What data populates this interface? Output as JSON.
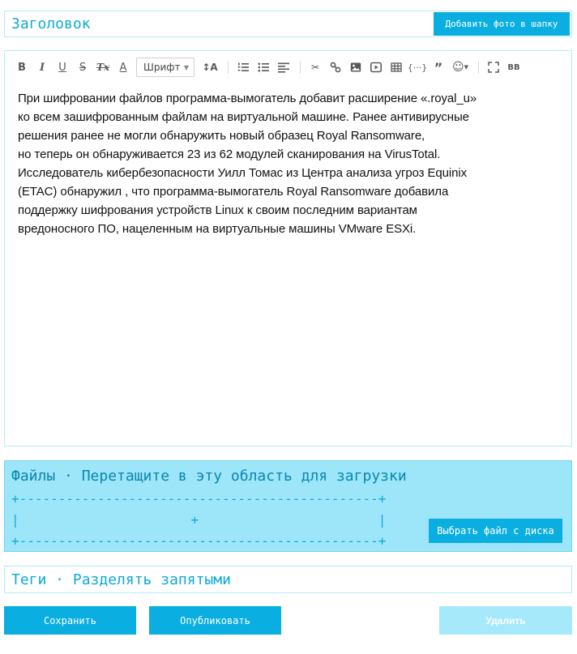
{
  "title_field": {
    "placeholder": "Заголовок",
    "value": ""
  },
  "header_photo_button": {
    "label": "Добавить фото в шапку"
  },
  "toolbar": {
    "bold_label": "B",
    "italic_label": "I",
    "underline_label": "U",
    "strike_label": "S",
    "clear_format_label": "Tx",
    "font_color_label": "A",
    "font_select_value": "Шрифт",
    "font_size_label": "↕A",
    "quote_label": "”",
    "bbcode_label": "BB"
  },
  "editor": {
    "content_lines": [
      "При шифровании файлов программа-вымогатель добавит расширение «.royal_u»",
      "ко всем зашифрованным файлам на виртуальной машине. Ранее антивирусные",
      "решения ранее не могли обнаружить новый образец Royal Ransomware,",
      "но теперь он обнаруживается 23 из 62 модулей сканирования на VirusTotal.",
      "Исследователь кибербезопасности Уилл Томас из Центра анализа угроз Equinix",
      "(ETAC) обнаружил , что программа-вымогатель Royal Ransomware добавила",
      "поддержку шифрования устройств Linux к своим последним вариантам",
      "вредоносного ПО, нацеленным на виртуальные машины VMware ESXi."
    ]
  },
  "dropzone": {
    "title": "Файлы · Перетащите в эту область для загрузки",
    "ascii_top": "+----------------------------------------------+",
    "ascii_middle": "|                      +                       |",
    "ascii_bottom": "+----------------------------------------------+",
    "choose_file_label": "Выбрать файл с диска"
  },
  "tags_field": {
    "placeholder": "Теги · Разделять запятыми",
    "value": ""
  },
  "actions": {
    "save_label": "Сохранить",
    "publish_label": "Опубликовать",
    "delete_label": "Удалить"
  },
  "colors": {
    "accent": "#0aaee0",
    "accent_light": "#9de6fa",
    "border": "#b7eaf9",
    "placeholder_text": "#10a9d6"
  }
}
